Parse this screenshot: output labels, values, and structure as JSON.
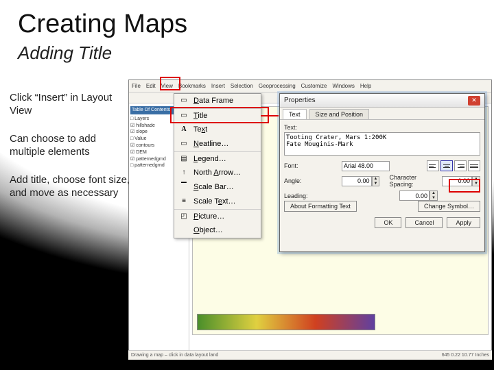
{
  "slide": {
    "title": "Creating Maps",
    "subtitle": "Adding Title",
    "para1": "Click “Insert” in Layout View",
    "para2": "Can choose to add multiple elements",
    "para3": "Add title, choose font size, and move as necessary"
  },
  "menubar": {
    "items": [
      "File",
      "Edit",
      "View",
      "Bookmarks",
      "Insert",
      "Selection",
      "Geoprocessing",
      "Customize",
      "Windows",
      "Help"
    ]
  },
  "sidepanel": {
    "header": "Table Of Contents",
    "items": [
      "□ Layers",
      "  ☑ hillshade",
      "  ☑ slope",
      "    □ Value",
      "  ☑ contours",
      "  ☑ DEM",
      "  ☑ patternedgrnd",
      "    □ patternedgrnd"
    ]
  },
  "insert_menu": {
    "items": [
      {
        "icon": "▭",
        "label_pre": "",
        "ul": "D",
        "label_post": "ata Frame"
      },
      {
        "icon": "▭",
        "label_pre": "",
        "ul": "T",
        "label_post": "itle",
        "sep": true
      },
      {
        "icon": "A",
        "label_pre": "Te",
        "ul": "x",
        "label_post": "t"
      },
      {
        "icon": "▭",
        "label_pre": "",
        "ul": "N",
        "label_post": "eatline…"
      },
      {
        "icon": "▤",
        "label_pre": "",
        "ul": "L",
        "label_post": "egend…",
        "sep": true
      },
      {
        "icon": "↑",
        "label_pre": "North ",
        "ul": "A",
        "label_post": "rrow…"
      },
      {
        "icon": "▔",
        "label_pre": "",
        "ul": "S",
        "label_post": "cale Bar…"
      },
      {
        "icon": "≡",
        "label_pre": "Scale T",
        "ul": "e",
        "label_post": "xt…"
      },
      {
        "icon": "◰",
        "label_pre": "",
        "ul": "P",
        "label_post": "icture…",
        "sep": true
      },
      {
        "icon": "",
        "label_pre": "",
        "ul": "O",
        "label_post": "bject…"
      }
    ]
  },
  "props": {
    "title": "Properties",
    "tab1": "Text",
    "tab2": "Size and Position",
    "text_label": "Text:",
    "text_value": "Tooting Crater, Mars 1:200K\nFate Mouginis-Mark",
    "font_label": "Font:",
    "font_value": "Arial 48.00",
    "angle_label": "Angle:",
    "angle_value": "0.00",
    "charspacing_label": "Character Spacing:",
    "charspacing_value": "0.00",
    "leading_label": "Leading:",
    "leading_value": "0.00",
    "about_fmt": "About Formatting Text",
    "change_symbol": "Change Symbol…",
    "ok": "OK",
    "cancel": "Cancel",
    "apply": "Apply"
  },
  "statusbar": {
    "left": "Drawing a map – click in data layout land",
    "right": "645   0.22 10.77 Inches"
  }
}
